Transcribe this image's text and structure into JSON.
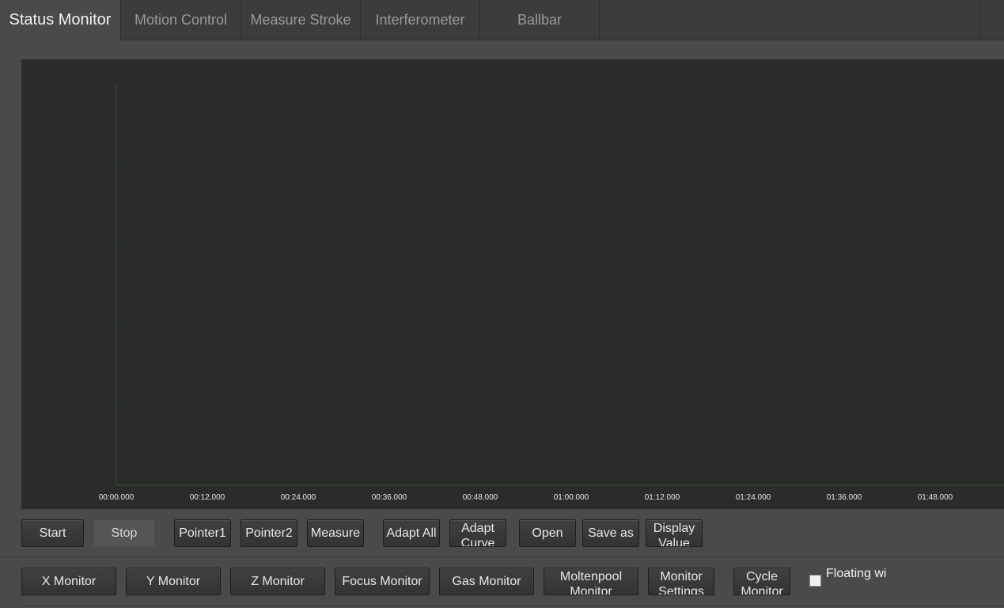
{
  "tabs": [
    {
      "label": "Status Monitor",
      "active": true
    },
    {
      "label": "Motion Control",
      "active": false
    },
    {
      "label": "Measure Stroke",
      "active": false
    },
    {
      "label": "Interferometer",
      "active": false
    },
    {
      "label": "Ballbar",
      "active": false
    }
  ],
  "chart": {
    "x_ticks": [
      "00:00.000",
      "00:12.000",
      "00:24.000",
      "00:36.000",
      "00:48.000",
      "01:00.000",
      "01:12.000",
      "01:24.000",
      "01:36.000",
      "01:48.000"
    ],
    "colors": {
      "background": "#2b2b2b",
      "grid": "#253b25",
      "axis": "#2f5a2f"
    }
  },
  "toolbar1": {
    "start": "Start",
    "stop": "Stop",
    "pointer1": "Pointer1",
    "pointer2": "Pointer2",
    "measure": "Measure",
    "adapt_all": "Adapt All",
    "adapt_curve": "Adapt\nCurve",
    "open": "Open",
    "save_as": "Save as",
    "display_value": "Display\nValue"
  },
  "toolbar2": {
    "x_monitor": "X Monitor",
    "y_monitor": "Y Monitor",
    "z_monitor": "Z Monitor",
    "focus_monitor": "Focus Monitor",
    "gas_monitor": "Gas Monitor",
    "moltenpool_monitor": "Moltenpool\nMonitor",
    "monitor_settings": "Monitor\nSettings",
    "cycle_monitor": "Cycle\nMonitor",
    "floating_label": "Floating wi"
  }
}
